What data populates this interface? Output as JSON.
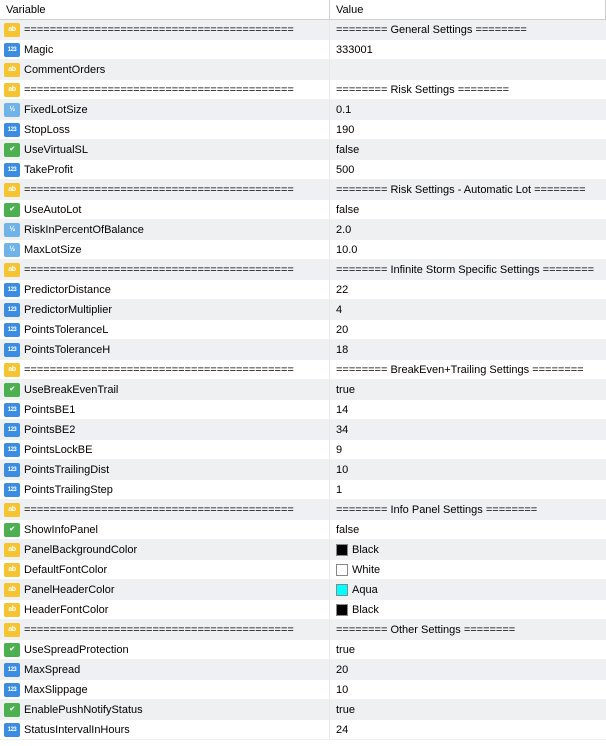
{
  "columns": {
    "variable": "Variable",
    "value": "Value"
  },
  "section_separator": "==========================================",
  "sections": {
    "general": "======== General Settings ========",
    "risk": "======== Risk Settings ========",
    "risk_auto": "======== Risk Settings - Automatic Lot ========",
    "storm": "======== Infinite Storm Specific Settings ========",
    "be": "======== BreakEven+Trailing Settings ========",
    "info": "======== Info Panel Settings ========",
    "other": "======== Other Settings ========"
  },
  "rows": [
    {
      "type": "ab",
      "name_key": "section_separator",
      "value_key": "sections.general"
    },
    {
      "type": "123",
      "name": "Magic",
      "value": "333001"
    },
    {
      "type": "ab",
      "name": "CommentOrders",
      "value": ""
    },
    {
      "type": "ab",
      "name_key": "section_separator",
      "value_key": "sections.risk"
    },
    {
      "type": "v2",
      "name": "FixedLotSize",
      "value": "0.1"
    },
    {
      "type": "123",
      "name": "StopLoss",
      "value": "190"
    },
    {
      "type": "bool",
      "name": "UseVirtualSL",
      "value": "false"
    },
    {
      "type": "123",
      "name": "TakeProfit",
      "value": "500"
    },
    {
      "type": "ab",
      "name_key": "section_separator",
      "value_key": "sections.risk_auto"
    },
    {
      "type": "bool",
      "name": "UseAutoLot",
      "value": "false"
    },
    {
      "type": "v2",
      "name": "RiskInPercentOfBalance",
      "value": "2.0"
    },
    {
      "type": "v2",
      "name": "MaxLotSize",
      "value": "10.0"
    },
    {
      "type": "ab",
      "name_key": "section_separator",
      "value_key": "sections.storm"
    },
    {
      "type": "123",
      "name": "PredictorDistance",
      "value": "22"
    },
    {
      "type": "123",
      "name": "PredictorMultiplier",
      "value": "4"
    },
    {
      "type": "123",
      "name": "PointsToleranceL",
      "value": "20"
    },
    {
      "type": "123",
      "name": "PointsToleranceH",
      "value": "18"
    },
    {
      "type": "ab",
      "name_key": "section_separator",
      "value_key": "sections.be"
    },
    {
      "type": "bool",
      "name": "UseBreakEvenTrail",
      "value": "true"
    },
    {
      "type": "123",
      "name": "PointsBE1",
      "value": "14"
    },
    {
      "type": "123",
      "name": "PointsBE2",
      "value": "34"
    },
    {
      "type": "123",
      "name": "PointsLockBE",
      "value": "9"
    },
    {
      "type": "123",
      "name": "PointsTrailingDist",
      "value": "10"
    },
    {
      "type": "123",
      "name": "PointsTrailingStep",
      "value": "1"
    },
    {
      "type": "ab",
      "name_key": "section_separator",
      "value_key": "sections.info"
    },
    {
      "type": "bool",
      "name": "ShowInfoPanel",
      "value": "false"
    },
    {
      "type": "color",
      "name": "PanelBackgroundColor",
      "value": "Black",
      "swatch": "#000000"
    },
    {
      "type": "color",
      "name": "DefaultFontColor",
      "value": "White",
      "swatch": "#ffffff"
    },
    {
      "type": "color",
      "name": "PanelHeaderColor",
      "value": "Aqua",
      "swatch": "#00ffff"
    },
    {
      "type": "color",
      "name": "HeaderFontColor",
      "value": "Black",
      "swatch": "#000000"
    },
    {
      "type": "ab",
      "name_key": "section_separator",
      "value_key": "sections.other"
    },
    {
      "type": "bool",
      "name": "UseSpreadProtection",
      "value": "true"
    },
    {
      "type": "123",
      "name": "MaxSpread",
      "value": "20"
    },
    {
      "type": "123",
      "name": "MaxSlippage",
      "value": "10"
    },
    {
      "type": "bool",
      "name": "EnablePushNotifyStatus",
      "value": "true"
    },
    {
      "type": "123",
      "name": "StatusIntervalInHours",
      "value": "24"
    }
  ],
  "icon_labels": {
    "ab": "ab",
    "123": "123",
    "bool": "✔",
    "v2": "½",
    "color": "ab"
  }
}
